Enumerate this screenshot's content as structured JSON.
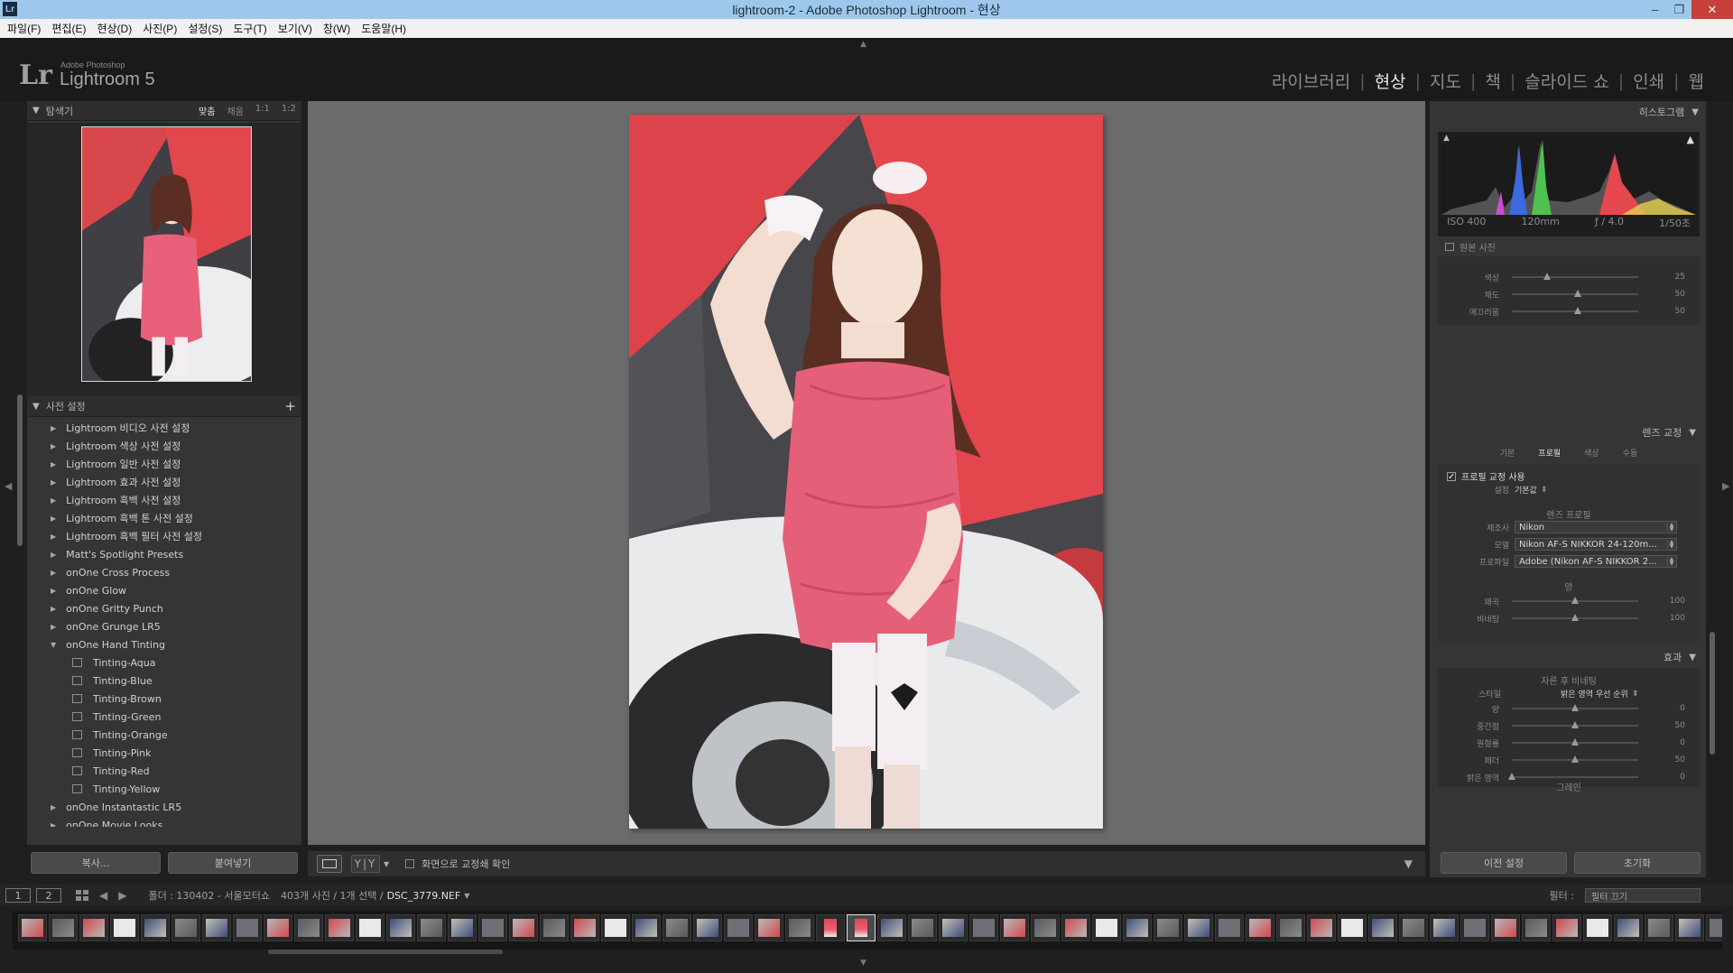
{
  "window": {
    "title": "lightroom-2 - Adobe Photoshop Lightroom - 현상",
    "app_icon": "Lr"
  },
  "menu": [
    "파일(F)",
    "편집(E)",
    "현상(D)",
    "사진(P)",
    "설정(S)",
    "도구(T)",
    "보기(V)",
    "창(W)",
    "도움말(H)"
  ],
  "brand": {
    "mark": "Lr",
    "adobe": "Adobe Photoshop",
    "name": "Lightroom 5"
  },
  "modules": [
    "라이브러리",
    "현상",
    "지도",
    "책",
    "슬라이드 쇼",
    "인쇄",
    "웹"
  ],
  "active_module": "현상",
  "navigator": {
    "title": "탐색기",
    "zoom": [
      "맞춤",
      "채움",
      "1:1",
      "1:2"
    ]
  },
  "presets": {
    "title": "사전 설정",
    "items": [
      {
        "label": "Lightroom 비디오 사전 설정",
        "level": 0,
        "open": false
      },
      {
        "label": "Lightroom 색상 사전 설정",
        "level": 0,
        "open": false
      },
      {
        "label": "Lightroom 일반 사전 설정",
        "level": 0,
        "open": false
      },
      {
        "label": "Lightroom 효과 사전 설정",
        "level": 0,
        "open": false
      },
      {
        "label": "Lightroom 흑백 사전 설정",
        "level": 0,
        "open": false
      },
      {
        "label": "Lightroom 흑백 톤 사전 설정",
        "level": 0,
        "open": false
      },
      {
        "label": "Lightroom 흑백 필터 사전 설정",
        "level": 0,
        "open": false
      },
      {
        "label": "Matt's Spotlight Presets",
        "level": 0,
        "open": false
      },
      {
        "label": "onOne Cross Process",
        "level": 0,
        "open": false
      },
      {
        "label": "onOne Glow",
        "level": 0,
        "open": false
      },
      {
        "label": "onOne Gritty Punch",
        "level": 0,
        "open": false
      },
      {
        "label": "onOne Grunge LR5",
        "level": 0,
        "open": false
      },
      {
        "label": "onOne Hand Tinting",
        "level": 0,
        "open": true
      },
      {
        "label": "Tinting-Aqua",
        "level": 1
      },
      {
        "label": "Tinting-Blue",
        "level": 1
      },
      {
        "label": "Tinting-Brown",
        "level": 1
      },
      {
        "label": "Tinting-Green",
        "level": 1
      },
      {
        "label": "Tinting-Orange",
        "level": 1
      },
      {
        "label": "Tinting-Pink",
        "level": 1
      },
      {
        "label": "Tinting-Red",
        "level": 1
      },
      {
        "label": "Tinting-Yellow",
        "level": 1
      },
      {
        "label": "onOne Instantastic LR5",
        "level": 0,
        "open": false
      },
      {
        "label": "onOne Movie Looks",
        "level": 0,
        "open": false
      }
    ]
  },
  "left_buttons": {
    "copy": "복사...",
    "paste": "붙여넣기"
  },
  "toolbar": {
    "yy": "Y|Y",
    "checkbox": "화면으로 교정쇄 확인"
  },
  "histogram": {
    "title": "히스토그램",
    "iso": "ISO 400",
    "focal": "120mm",
    "aperture": "ƒ / 4.0",
    "shutter": "1/50초",
    "original": "원본 사진"
  },
  "top_sliders": [
    {
      "label": "색상",
      "value": "25",
      "pos": 0.28
    },
    {
      "label": "채도",
      "value": "50",
      "pos": 0.52
    },
    {
      "label": "매끄러움",
      "value": "50",
      "pos": 0.52
    }
  ],
  "lens": {
    "title": "렌즈 교정",
    "tabs": [
      "기본",
      "프로필",
      "색상",
      "수동"
    ],
    "active_tab": "프로필",
    "enable": "프로필 교정 사용",
    "setup_label": "설정",
    "setup_value": "기본값",
    "profile_title": "렌즈 프로필",
    "make_label": "제조사",
    "make": "Nikon",
    "model_label": "모델",
    "model": "Nikon AF-S NIKKOR 24-120m...",
    "profile_label": "프로파일",
    "profile": "Adobe (Nikon AF-S NIKKOR 2...",
    "amount_title": "양",
    "sliders": [
      {
        "label": "왜곡",
        "value": "100",
        "pos": 0.5
      },
      {
        "label": "비네팅",
        "value": "100",
        "pos": 0.5
      }
    ]
  },
  "effects": {
    "title": "효과",
    "subtitle": "자른 후 비네팅",
    "style_label": "스타일",
    "style": "밝은 영역 우선 순위",
    "sliders": [
      {
        "label": "양",
        "value": "0",
        "pos": 0.5
      },
      {
        "label": "중간점",
        "value": "50",
        "pos": 0.5
      },
      {
        "label": "원형률",
        "value": "0",
        "pos": 0.5
      },
      {
        "label": "페더",
        "value": "50",
        "pos": 0.5
      },
      {
        "label": "밝은 영역",
        "value": "0",
        "pos": 0.0
      }
    ],
    "grain": "그레인"
  },
  "right_buttons": {
    "prev": "이전 설정",
    "reset": "초기화"
  },
  "filmbar": {
    "view1": "1",
    "view2": "2",
    "source": "폴더 : 130402 - 서울모터쇼",
    "count": "403개 사진 / 1개 선택 /",
    "file": "DSC_3779.NEF",
    "filter_label": "필터 :",
    "filter_value": "필터 끄기"
  },
  "colors": {
    "accent": "#e6e6e6",
    "panel": "#353535",
    "photo_bg": "#6b6b6b",
    "wall_red": "#e2474e",
    "dress": "#e8607a"
  }
}
